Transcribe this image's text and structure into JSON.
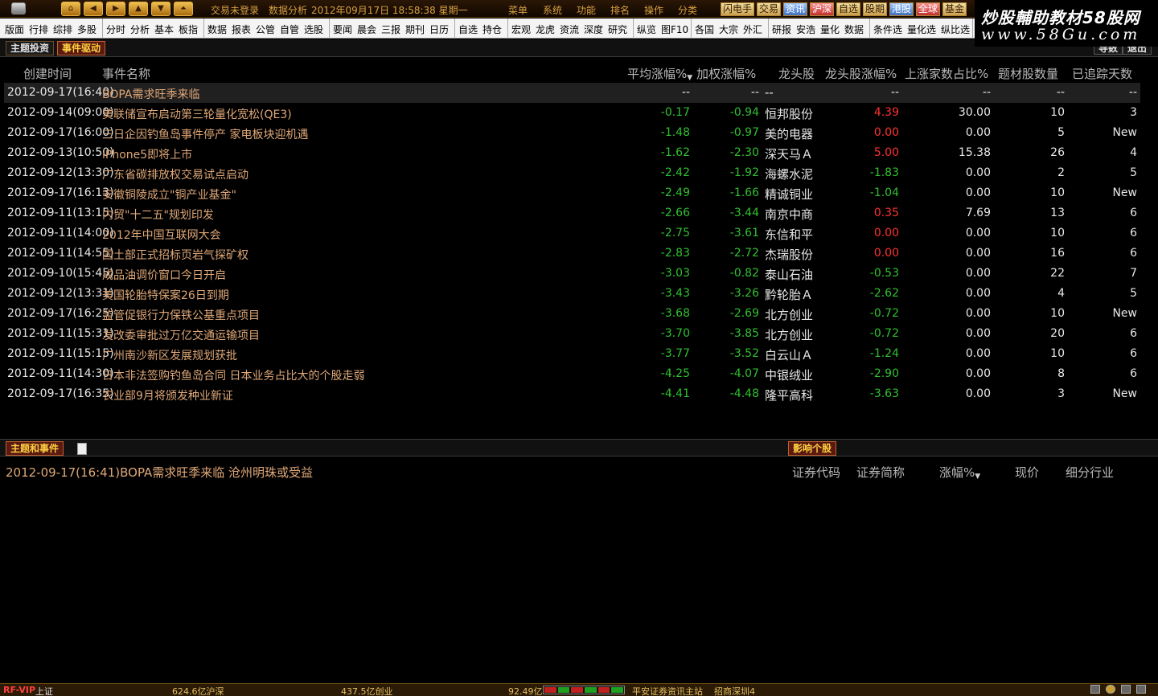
{
  "topbar": {
    "status_text": "交易未登录",
    "module": "数据分析",
    "datetime": "2012年09月17日  18:58:38  星期一",
    "menus": [
      "菜单",
      "系统",
      "功能",
      "排名",
      "操作",
      "分类"
    ],
    "quick_buttons": [
      "闪电手",
      "交易",
      "资讯",
      "沪深",
      "自选",
      "股期",
      "港股",
      "全球",
      "基金"
    ]
  },
  "watermark": {
    "line1": "炒股輔助教材58股网",
    "line2": "www.58Gu.com"
  },
  "toolbar": {
    "groups": [
      [
        "版面",
        "行排",
        "综排",
        "多股"
      ],
      [
        "分时",
        "分析",
        "基本",
        "板指"
      ],
      [
        "数据",
        "报表",
        "公管",
        "自管",
        "选股"
      ],
      [
        "要闻",
        "晨会",
        "三报",
        "期刊",
        "日历"
      ],
      [
        "自选",
        "持仓"
      ],
      [
        "宏观",
        "龙虎",
        "资流",
        "深度",
        "研究"
      ],
      [
        "纵览",
        "图F10"
      ],
      [
        "各国",
        "大宗",
        "外汇"
      ],
      [
        "研报",
        "安浩",
        "量化",
        "数据"
      ],
      [
        "条件选",
        "量化选",
        "纵比选"
      ]
    ]
  },
  "tabs": {
    "theme": "主题投资",
    "event": "事件驱动"
  },
  "right_buttons": {
    "export": "导数",
    "exit": "退出"
  },
  "table": {
    "headers": [
      "创建时间",
      "事件名称",
      "平均涨幅%",
      "加权涨幅%",
      "龙头股",
      "龙头股涨幅%",
      "上涨家数占比%",
      "题材股数量",
      "已追踪天数"
    ],
    "rows": [
      {
        "time": "2012-09-17(16:40)",
        "name": "BOPA需求旺季来临",
        "avg": "--",
        "wtd": "--",
        "lead": "--",
        "lead_chg": "--",
        "up_ratio": "--",
        "count": "--",
        "days": "--"
      },
      {
        "time": "2012-09-14(09:00)",
        "name": "美联储宣布启动第三轮量化宽松(QE3)",
        "avg": "-0.17",
        "wtd": "-0.94",
        "lead": "恒邦股份",
        "lead_chg": "4.39",
        "up_ratio": "30.00",
        "count": "10",
        "days": "3"
      },
      {
        "time": "2012-09-17(16:00)",
        "name": "三日企因钓鱼岛事件停产 家电板块迎机遇",
        "avg": "-1.48",
        "wtd": "-0.97",
        "lead": "美的电器",
        "lead_chg": "0.00",
        "up_ratio": "0.00",
        "count": "5",
        "days": "New"
      },
      {
        "time": "2012-09-13(10:50)",
        "name": "iPhone5即将上市",
        "avg": "-1.62",
        "wtd": "-2.30",
        "lead": "深天马Ａ",
        "lead_chg": "5.00",
        "up_ratio": "15.38",
        "count": "26",
        "days": "4"
      },
      {
        "time": "2012-09-12(13:30)",
        "name": "广东省碳排放权交易试点启动",
        "avg": "-2.42",
        "wtd": "-1.92",
        "lead": "海螺水泥",
        "lead_chg": "-1.83",
        "up_ratio": "0.00",
        "count": "2",
        "days": "5"
      },
      {
        "time": "2012-09-17(16:13)",
        "name": "安徽铜陵成立\"铜产业基金\"",
        "avg": "-2.49",
        "wtd": "-1.66",
        "lead": "精诚铜业",
        "lead_chg": "-1.04",
        "up_ratio": "0.00",
        "count": "10",
        "days": "New"
      },
      {
        "time": "2012-09-11(13:15)",
        "name": "内贸\"十二五\"规划印发",
        "avg": "-2.66",
        "wtd": "-3.44",
        "lead": "南京中商",
        "lead_chg": "0.35",
        "up_ratio": "7.69",
        "count": "13",
        "days": "6"
      },
      {
        "time": "2012-09-11(14:00)",
        "name": "2012年中国互联网大会",
        "avg": "-2.75",
        "wtd": "-3.61",
        "lead": "东信和平",
        "lead_chg": "0.00",
        "up_ratio": "0.00",
        "count": "10",
        "days": "6"
      },
      {
        "time": "2012-09-11(14:55)",
        "name": "国土部正式招标页岩气探矿权",
        "avg": "-2.83",
        "wtd": "-2.72",
        "lead": "杰瑞股份",
        "lead_chg": "0.00",
        "up_ratio": "0.00",
        "count": "16",
        "days": "6"
      },
      {
        "time": "2012-09-10(15:45)",
        "name": "成品油调价窗口今日开启",
        "avg": "-3.03",
        "wtd": "-0.82",
        "lead": "泰山石油",
        "lead_chg": "-0.53",
        "up_ratio": "0.00",
        "count": "22",
        "days": "7"
      },
      {
        "time": "2012-09-12(13:31)",
        "name": "美国轮胎特保案26日到期",
        "avg": "-3.43",
        "wtd": "-3.26",
        "lead": "黔轮胎Ａ",
        "lead_chg": "-2.62",
        "up_ratio": "0.00",
        "count": "4",
        "days": "5"
      },
      {
        "time": "2012-09-17(16:25)",
        "name": "监管促银行力保铁公基重点项目",
        "avg": "-3.68",
        "wtd": "-2.69",
        "lead": "北方创业",
        "lead_chg": "-0.72",
        "up_ratio": "0.00",
        "count": "10",
        "days": "New"
      },
      {
        "time": "2012-09-11(15:31)",
        "name": "发改委审批过万亿交通运输项目",
        "avg": "-3.70",
        "wtd": "-3.85",
        "lead": "北方创业",
        "lead_chg": "-0.72",
        "up_ratio": "0.00",
        "count": "20",
        "days": "6"
      },
      {
        "time": "2012-09-11(15:15)",
        "name": "广州南沙新区发展规划获批",
        "avg": "-3.77",
        "wtd": "-3.52",
        "lead": "白云山Ａ",
        "lead_chg": "-1.24",
        "up_ratio": "0.00",
        "count": "10",
        "days": "6"
      },
      {
        "time": "2012-09-11(14:30)",
        "name": "日本非法签购钓鱼岛合同 日本业务占比大的个股走弱",
        "avg": "-4.25",
        "wtd": "-4.07",
        "lead": "中银绒业",
        "lead_chg": "-2.90",
        "up_ratio": "0.00",
        "count": "8",
        "days": "6"
      },
      {
        "time": "2012-09-17(16:35)",
        "name": "农业部9月将颁发种业新证",
        "avg": "-4.41",
        "wtd": "-4.48",
        "lead": "隆平高科",
        "lead_chg": "-3.63",
        "up_ratio": "0.00",
        "count": "3",
        "days": "New"
      }
    ]
  },
  "lower": {
    "tab_left": "主题和事件",
    "tab_right": "影响个股",
    "news": "2012-09-17(16:41)BOPA需求旺季来临 沧州明珠或受益",
    "stock_headers": [
      "证券代码",
      "证券简称",
      "涨幅%",
      "现价",
      "细分行业"
    ]
  },
  "statusbar": {
    "vip": "RF-VIP",
    "index": "上证",
    "sh_amount": "624.6亿沪深",
    "cy_amount": "437.5亿创业",
    "small_amount": "92.49亿",
    "broker": "平安证券资讯主站",
    "server": "招商深圳4"
  },
  "colors": {
    "up": "#ff3030",
    "down": "#30c030",
    "event_name": "#e0a878",
    "accent": "#d8a040"
  }
}
